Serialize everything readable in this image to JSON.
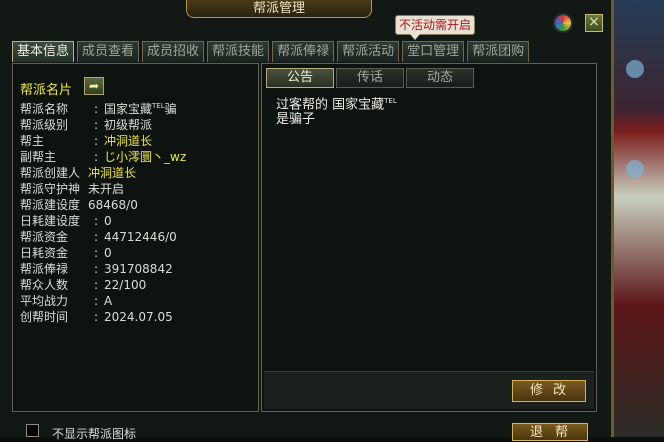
{
  "window": {
    "title": "帮派管理"
  },
  "notice_tag": "不活动需开启",
  "close_label": "×",
  "tabs": [
    "基本信息",
    "成员查看",
    "成员招收",
    "帮派技能",
    "帮派俸禄",
    "帮派活动",
    "堂口管理",
    "帮派团购"
  ],
  "card": {
    "title": "帮派名片",
    "share_icon": "share-arrow-icon"
  },
  "info": {
    "name": {
      "label": "帮派名称",
      "value": "国家宝藏",
      "tag": "TEL",
      "suffix": "骗"
    },
    "level": {
      "label": "帮派级别",
      "value": "初级帮派"
    },
    "leader": {
      "label": "帮主",
      "value": "冲洞道长"
    },
    "vice": {
      "label": "副帮主",
      "value": "じ小澪圜丶_wz"
    },
    "founder": {
      "label": "帮派创建人",
      "value": "冲洞道长"
    },
    "guardian": {
      "label": "帮派守护神",
      "value": "未开启"
    },
    "build": {
      "label": "帮派建设度",
      "value": "68468/0"
    },
    "daily_build": {
      "label": "日耗建设度",
      "value": "0"
    },
    "funds": {
      "label": "帮派资金",
      "value": "44712446/0"
    },
    "daily_funds": {
      "label": "日耗资金",
      "value": "0"
    },
    "salary": {
      "label": "帮派俸禄",
      "value": "391708842"
    },
    "members": {
      "label": "帮众人数",
      "value": "22/100"
    },
    "power": {
      "label": "平均战力",
      "value": "A"
    },
    "created": {
      "label": "创帮时间",
      "value": "2024.07.05"
    }
  },
  "right_tabs": [
    "公告",
    "传话",
    "动态"
  ],
  "notice": {
    "line1_prefix": "过客帮的 国家宝藏",
    "line1_tag": "TEL",
    "line2": "是骗子"
  },
  "edit_label": "修改",
  "bottom": {
    "checkbox_label": "不显示帮派图标",
    "leave_label": "退帮"
  },
  "colors": {
    "highlight": "#ede440",
    "button": "#7a5a1c",
    "notice_text": "#b1141b"
  }
}
